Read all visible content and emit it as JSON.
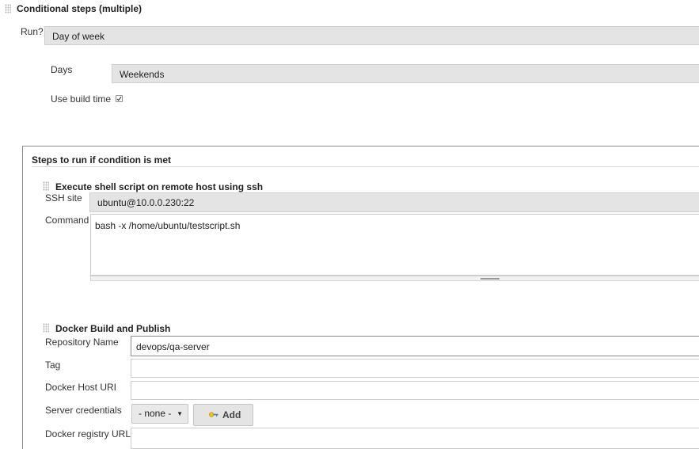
{
  "header": {
    "title": "Conditional steps (multiple)"
  },
  "run": {
    "label": "Run?",
    "value": "Day of week"
  },
  "days": {
    "label": "Days",
    "value": "Weekends"
  },
  "build_time": {
    "label": "Use build time",
    "checked": true
  },
  "steps_section": {
    "title": "Steps to run if condition is met"
  },
  "ssh_step": {
    "title": "Execute shell script on remote host using ssh",
    "site_label": "SSH site",
    "site_value": "ubuntu@10.0.0.230:22",
    "command_label": "Command",
    "command_value": "bash -x /home/ubuntu/testscript.sh"
  },
  "docker_step": {
    "title": "Docker Build and Publish",
    "repo_label": "Repository Name",
    "repo_value": "devops/qa-server",
    "tag_label": "Tag",
    "tag_value": "",
    "host_label": "Docker Host URI",
    "host_value": "",
    "credentials_label": "Server credentials",
    "credentials_value": "- none -",
    "add_label": "Add",
    "registry_label": "Docker registry URL",
    "registry_value": ""
  },
  "icons": {
    "grip": "drag-handle-icon",
    "key": "key-icon",
    "dropdown": "chevron-down-icon"
  }
}
